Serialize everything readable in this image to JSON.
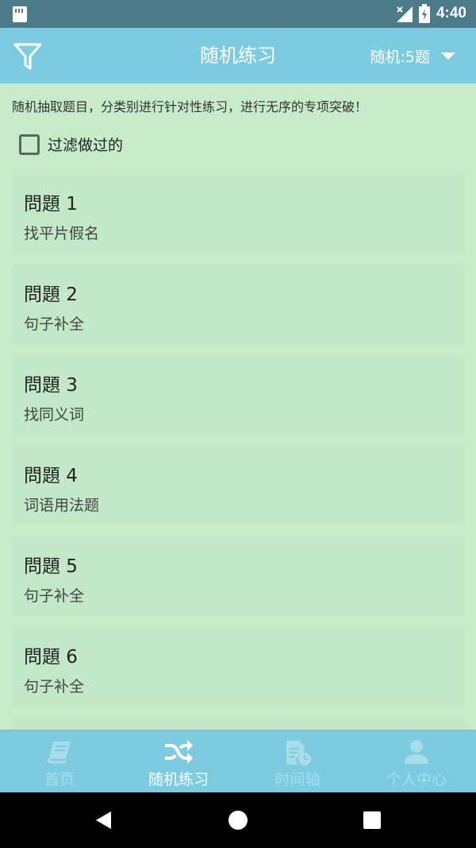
{
  "status_bar": {
    "time": "4:40"
  },
  "app_bar": {
    "title": "随机练习",
    "mode_label": "随机:5题"
  },
  "description": "随机抽取题目，分类别进行针对性练习，进行无序的专项突破！",
  "filter": {
    "label": "过滤做过的",
    "checked": false
  },
  "questions": [
    {
      "title": "問題 1",
      "category": "找平片假名"
    },
    {
      "title": "問題 2",
      "category": "句子补全"
    },
    {
      "title": "問題 3",
      "category": "找同义词"
    },
    {
      "title": "問題 4",
      "category": "词语用法题"
    },
    {
      "title": "問題 5",
      "category": "句子补全"
    },
    {
      "title": "問題 6",
      "category": "句子补全"
    }
  ],
  "bottom_nav": [
    {
      "label": "首页",
      "icon": "book-icon",
      "active": false
    },
    {
      "label": "随机练习",
      "icon": "shuffle-icon",
      "active": true
    },
    {
      "label": "时间轴",
      "icon": "timeline-icon",
      "active": false
    },
    {
      "label": "个人中心",
      "icon": "person-icon",
      "active": false
    }
  ],
  "colors": {
    "status_bar": "#4b7a88",
    "app_bar": "#7ccbe0",
    "background": "#c8ecca",
    "card": "#c2e8c8",
    "nav_inactive": "#a7dcea"
  }
}
